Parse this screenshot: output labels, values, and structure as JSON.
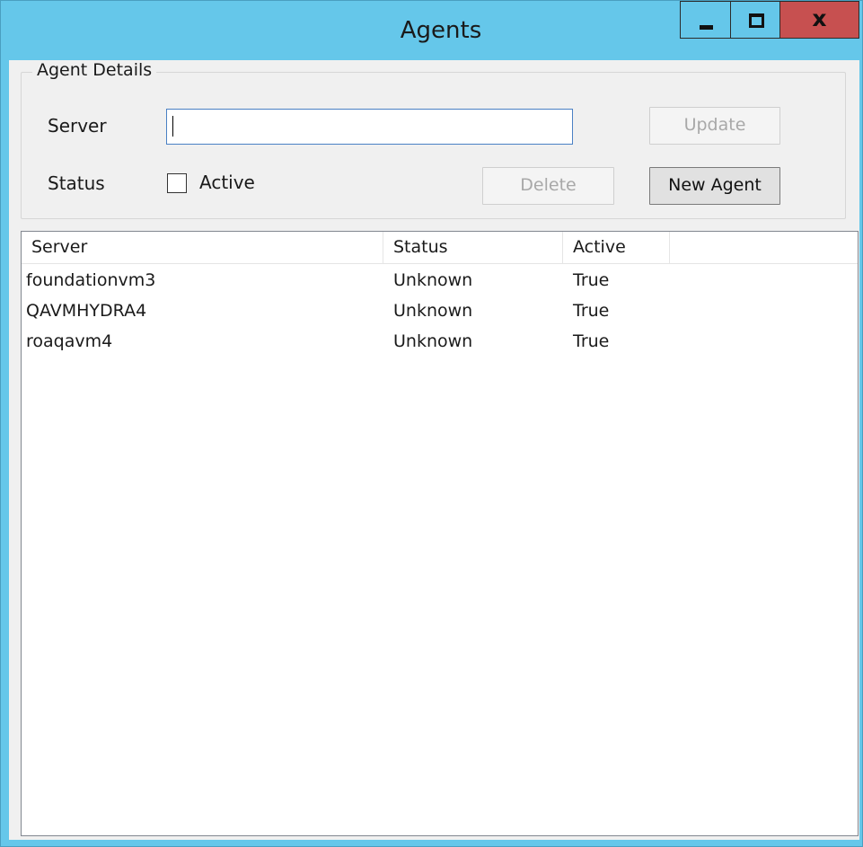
{
  "window": {
    "title": "Agents",
    "minimize_icon": "minimize-icon",
    "maximize_icon": "maximize-icon",
    "close_glyph": "x"
  },
  "agent_details": {
    "legend": "Agent Details",
    "server_label": "Server",
    "server_value": "",
    "status_label": "Status",
    "active_label": "Active",
    "active_checked": false,
    "update_label": "Update",
    "delete_label": "Delete",
    "new_agent_label": "New Agent"
  },
  "agents_list": {
    "columns": [
      "Server",
      "Status",
      "Active"
    ],
    "rows": [
      {
        "server": "foundationvm3",
        "status": "Unknown",
        "active": "True"
      },
      {
        "server": "QAVMHYDRA4",
        "status": "Unknown",
        "active": "True"
      },
      {
        "server": "roaqavm4",
        "status": "Unknown",
        "active": "True"
      }
    ]
  },
  "colors": {
    "titlebar": "#65c7ea",
    "close_button": "#c75050",
    "client_bg": "#f0f0f0"
  }
}
